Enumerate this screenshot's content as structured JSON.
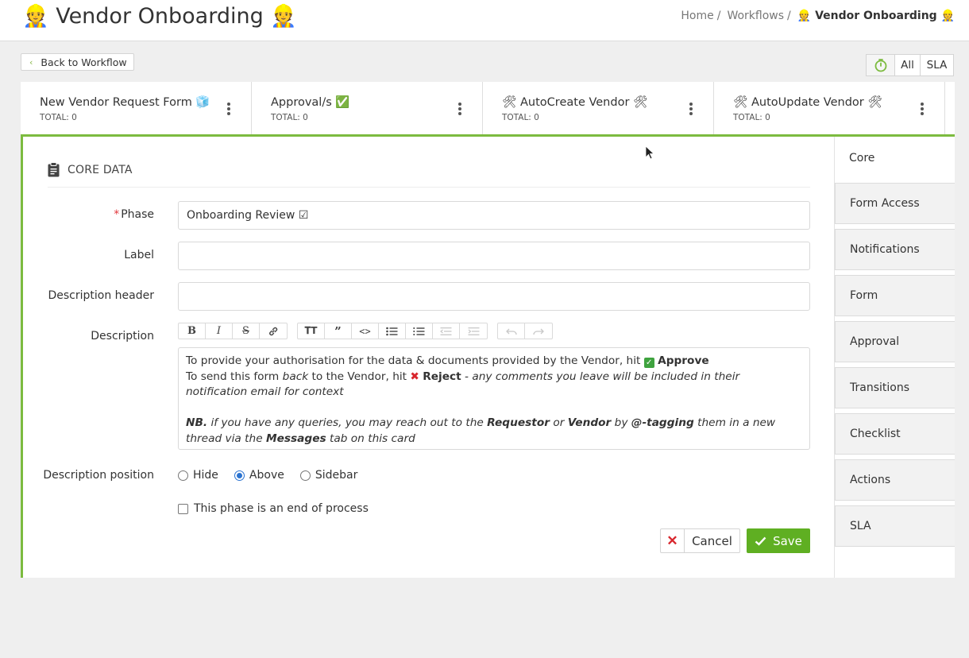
{
  "header": {
    "title": "👷 Vendor Onboarding 👷",
    "breadcrumb": [
      "Home",
      "Workflows",
      "👷 Vendor Onboarding 👷"
    ],
    "separator": "/"
  },
  "toolbar": {
    "back_label": "Back to Workflow",
    "filter_all": "All",
    "filter_sla": "SLA",
    "timer_icon": "stopwatch-icon"
  },
  "phases": [
    {
      "title": "New Vendor Request Form 🧊",
      "total": "TOTAL: 0"
    },
    {
      "title": "Approval/s ✅",
      "total": "TOTAL: 0"
    },
    {
      "title": "🛠 AutoCreate Vendor 🛠",
      "total": "TOTAL: 0"
    },
    {
      "title": "🛠 AutoUpdate Vendor 🛠",
      "total": "TOTAL: 0"
    }
  ],
  "core": {
    "heading": "CORE DATA",
    "phase_label": "Phase",
    "phase_required": "*",
    "phase_value": "Onboarding Review ☑",
    "label_label": "Label",
    "label_value": "",
    "desc_header_label": "Description header",
    "desc_header_value": "",
    "description_label": "Description",
    "description": {
      "line1_a": "To provide your authorisation for the data & documents provided by the Vendor, hit ",
      "line1_icon": "✓",
      "line1_b": "Approve",
      "line2_a": "To send this form ",
      "line2_back": "back",
      "line2_b": " to the Vendor, hit ",
      "line2_x": "✖",
      "line2_reject": "Reject",
      "line2_c": " - any comments you leave will be included in their notification email for context",
      "nb": "NB.",
      "nb_a": " if you have any queries, you may reach out to the ",
      "requestor": "Requestor",
      "or": " or ",
      "vendor": "Vendor",
      "by": " by ",
      "tagging": "@-tagging",
      "nb_b": " them in a new thread via the ",
      "messages": "Messages",
      "nb_c": " tab on this card"
    },
    "position_label": "Description position",
    "position_options": [
      "Hide",
      "Above",
      "Sidebar"
    ],
    "position_selected": "Above",
    "end_of_process_label": "This phase is an end of process",
    "cancel_label": "Cancel",
    "save_label": "Save"
  },
  "side_tabs": [
    "Core",
    "Form Access",
    "Notifications",
    "Form",
    "Approval",
    "Transitions",
    "Checklist",
    "Actions",
    "SLA"
  ],
  "colors": {
    "accent_green": "#7cbb3f",
    "save_green": "#5faf22",
    "reject_red": "#d8262d",
    "radio_blue": "#2b73d0"
  }
}
